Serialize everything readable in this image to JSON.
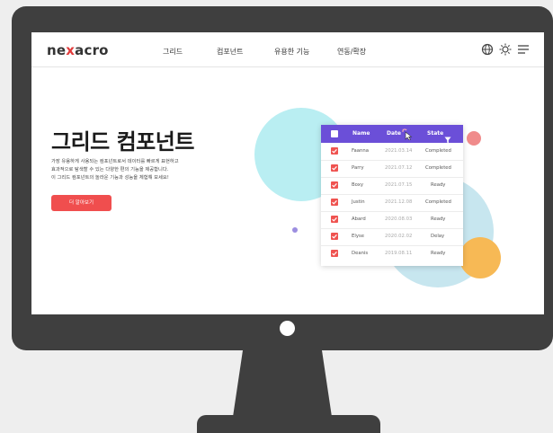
{
  "nav": {
    "logo": {
      "pre": "ne",
      "x": "x",
      "post": "acro"
    },
    "menu": [
      "그리드",
      "컴포넌트",
      "유용한 기능",
      "연동/확장"
    ],
    "icons": [
      "globe-icon",
      "brightness-icon",
      "hamburger-menu-icon"
    ]
  },
  "hero": {
    "title": "그리드 컴포넌트",
    "desc": [
      "가장 유용하게 사용되는 컴포넌트로서 데이터를 빠르게 표현하고",
      "효과적으로 탐색할 수 있는 다양한 편의 기능을 제공합니다.",
      "이 그리드 컴포넌트의 놀라운 기능과 성능을 체험해 보세요!"
    ],
    "cta": "더 알아보기"
  },
  "grid": {
    "headers": {
      "name": "Name",
      "date": "Date",
      "state": "State"
    },
    "rows": [
      {
        "name": "Faanna",
        "date": "2021.03.14",
        "state": "Completed"
      },
      {
        "name": "Parry",
        "date": "2021.07.12",
        "state": "Completed"
      },
      {
        "name": "Boxy",
        "date": "2021.07.15",
        "state": "Ready"
      },
      {
        "name": "Justin",
        "date": "2021.12.08",
        "state": "Completed"
      },
      {
        "name": "Abard",
        "date": "2020.08.03",
        "state": "Ready"
      },
      {
        "name": "Elyse",
        "date": "2020.02.02",
        "state": "Delay"
      },
      {
        "name": "Deanis",
        "date": "2019.08.11",
        "state": "Ready"
      }
    ]
  },
  "colors": {
    "accent": "#f04e4e",
    "grid_header": "#6b4fd8",
    "deco_cyan": "#b9eef2",
    "deco_pink": "#f08b8b",
    "deco_orange": "#f7b955",
    "deco_purple": "#9c8ee0"
  }
}
